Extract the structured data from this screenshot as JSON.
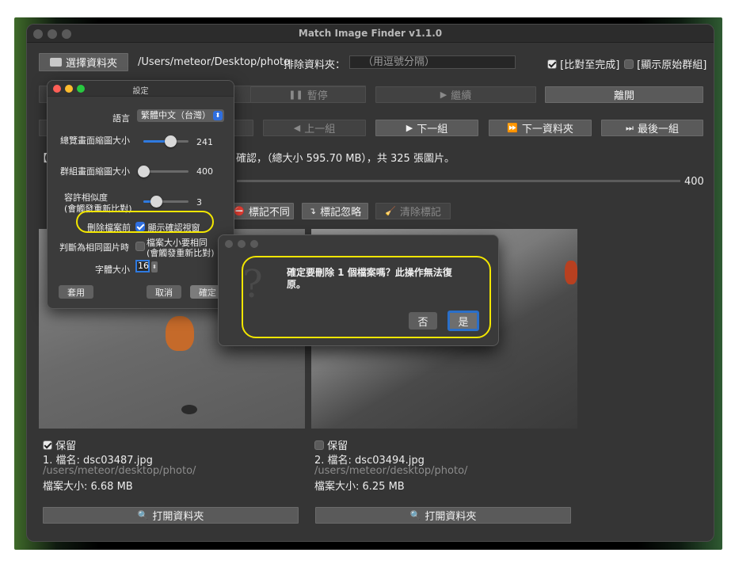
{
  "window": {
    "title": "Match Image Finder v1.1.0"
  },
  "toolbar": {
    "select_folder_label": "選擇資料夾",
    "path": "/Users/meteor/Desktop/photo",
    "exclude_label": "排除資料夾：",
    "exclude_placeholder": "（用逗號分隔）",
    "compare_complete_label": "[比對至完成]",
    "show_original_groups_label": "[顯示原始群組]"
  },
  "actions": {
    "pause_label": "暫停",
    "continue_label": "繼續",
    "exit_label": "離開"
  },
  "nav": {
    "prev_group_label": "上一組",
    "next_group_label": "下一組",
    "next_folder_label": "下一資料夾",
    "last_group_label": "最後一組"
  },
  "status": {
    "prefix": "【",
    "text": "確認，（總大小 595.70 MB），共 325 張圖片。",
    "threshold_value": "400"
  },
  "marks": {
    "mark_different_label": "標記不同",
    "mark_ignore_label": "標記忽略",
    "clear_marks_label": "清除標記"
  },
  "images": [
    {
      "keep_label": "保留",
      "keep_checked": true,
      "name": "1. 檔名: dsc03487.jpg",
      "path": "/users/meteor/desktop/photo/",
      "size": "檔案大小: 6.68 MB",
      "open_folder_label": "打開資料夾"
    },
    {
      "keep_label": "保留",
      "keep_checked": false,
      "name": "2. 檔名: dsc03494.jpg",
      "path": "/users/meteor/desktop/photo/",
      "size": "檔案大小: 6.25 MB",
      "open_folder_label": "打開資料夾"
    }
  ],
  "settings": {
    "title": "設定",
    "language_label": "語言",
    "language_value": "繁體中文（台灣）",
    "overview_scale_label": "總覽畫面縮圖大小",
    "overview_scale_value": "241",
    "overview_scale_fraction": 0.6,
    "group_scale_label": "群組畫面縮圖大小",
    "group_scale_value": "400",
    "group_scale_fraction": 0.0,
    "similarity_label_1": "容許相似度",
    "similarity_label_2": "(會觸發重新比對)",
    "similarity_value": "3",
    "similarity_fraction": 0.28,
    "before_delete_label": "刪除檔案前",
    "show_confirm_label": "顯示確認視窗",
    "same_image_label": "判斷為相同圖片時",
    "same_size_label_1": "檔案大小要相同",
    "same_size_label_2": "(會觸發重新比對)",
    "font_size_label": "字體大小",
    "font_size_value": "16",
    "apply_label": "套用",
    "cancel_label": "取消",
    "ok_label": "確定"
  },
  "confirm": {
    "message_line1": "確定要刪除 1 個檔案嗎？此操作無法復",
    "message_line2": "原。",
    "no_label": "否",
    "yes_label": "是"
  },
  "colors": {
    "highlight": "#f2e600",
    "accent": "#2f6fe0",
    "window_bg": "#353535"
  }
}
